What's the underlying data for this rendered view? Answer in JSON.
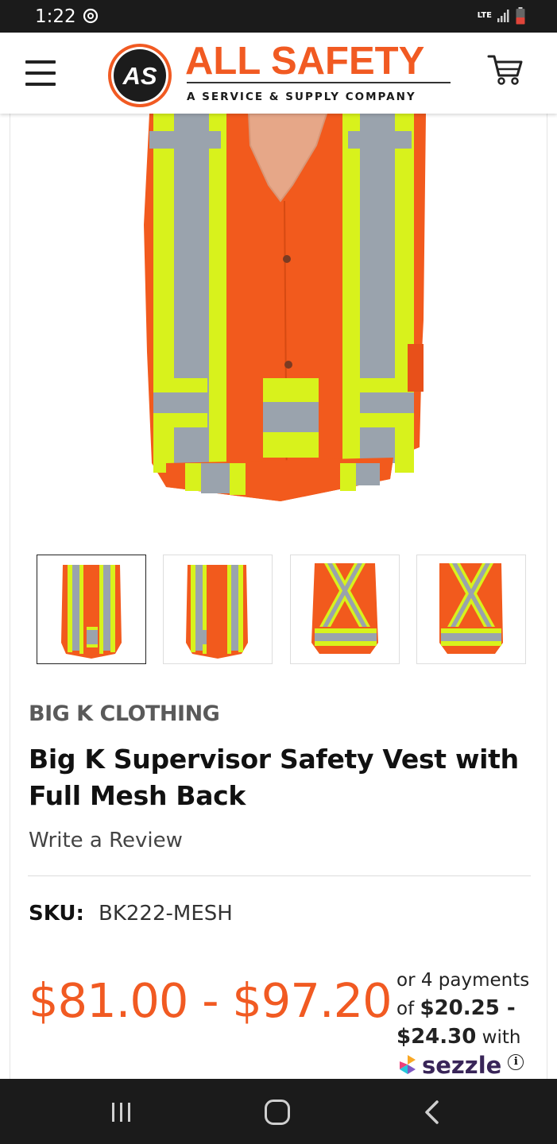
{
  "status_bar": {
    "time": "1:22",
    "network": "LTE",
    "icons": [
      "sync-icon",
      "signal-icon",
      "battery-icon"
    ]
  },
  "header": {
    "menu_icon": "hamburger-menu-icon",
    "logo_initials": "AS",
    "logo_title": "ALL SAFETY",
    "logo_subtitle": "A SERVICE & SUPPLY COMPANY",
    "cart_icon": "cart-icon"
  },
  "gallery": {
    "thumbnails": [
      {
        "view": "front",
        "active": true
      },
      {
        "view": "front-angled",
        "active": false
      },
      {
        "view": "back",
        "active": false
      },
      {
        "view": "back-angled",
        "active": false
      }
    ]
  },
  "product": {
    "brand": "BIG K CLOTHING",
    "title": "Big K Supervisor Safety Vest with Full Mesh Back",
    "review_link": "Write a Review",
    "sku_label": "SKU:",
    "sku_value": "BK222-MESH",
    "price_range": "$81.00 - $97.20"
  },
  "sezzle": {
    "prefix": "or 4 payments of",
    "amount": "$20.25 - $24.30",
    "suffix": "with",
    "brand": "sezzle",
    "info_icon": "i"
  },
  "colors": {
    "brand_orange": "#f15a22",
    "vest_orange": "#f25a1d",
    "reflective_yellow": "#d8f21c",
    "reflective_gray": "#9aa3ad",
    "system_bar": "#1b1b1b"
  }
}
